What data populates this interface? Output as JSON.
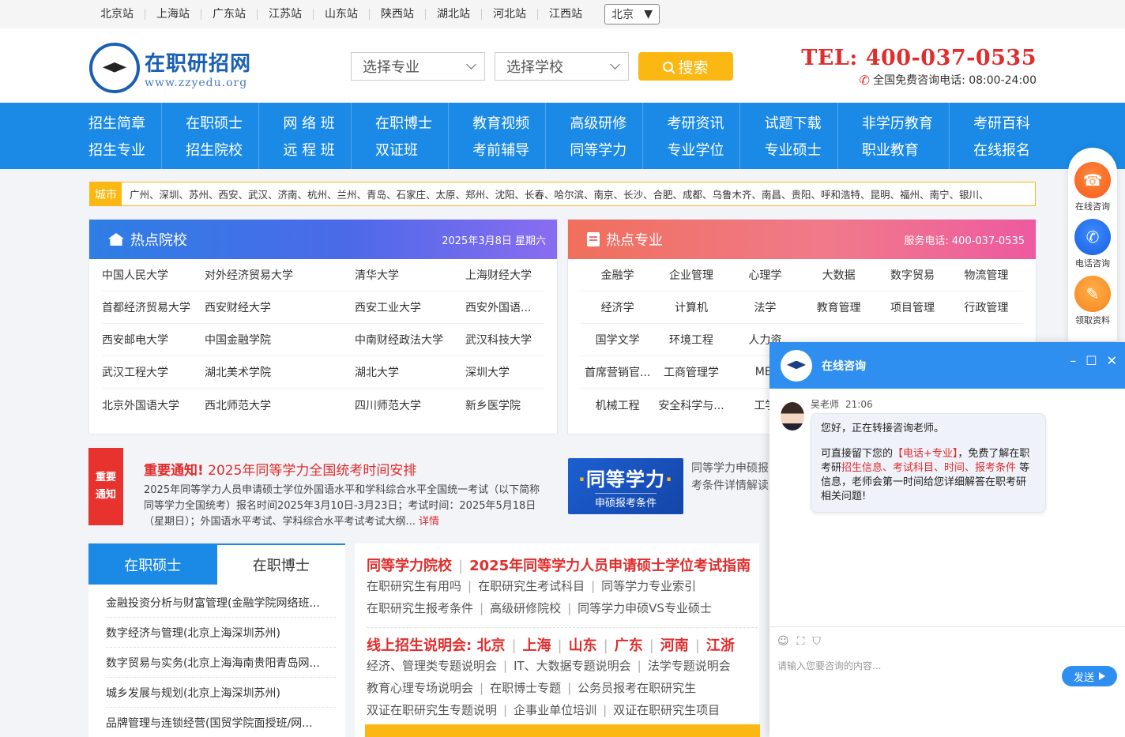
{
  "topbar": {
    "cities": [
      "北京站",
      "上海站",
      "广东站",
      "江苏站",
      "山东站",
      "陕西站",
      "湖北站",
      "河北站",
      "江西站"
    ],
    "city_select": "北京"
  },
  "header": {
    "logo_cn": "在职研招网",
    "logo_en": "www.zzyedu.org",
    "logo_ring": "WWW.ZZYEDU.ORG 在职研招网",
    "select_major": "选择专业",
    "select_school": "选择学校",
    "search_label": "搜索",
    "tel": "TEL: 400-037-0535",
    "tel_sub": "全国免费咨询电话: 08:00-24:00"
  },
  "nav": [
    [
      "招生简章",
      "招生专业"
    ],
    [
      "在职硕士",
      "招生院校"
    ],
    [
      "网 络 班",
      "远 程 班"
    ],
    [
      "在职博士",
      "双证班"
    ],
    [
      "教育视频",
      "考前辅导"
    ],
    [
      "高级研修",
      "同等学力"
    ],
    [
      "考研资讯",
      "专业学位"
    ],
    [
      "试题下载",
      "专业硕士"
    ],
    [
      "非学历教育",
      "职业教育"
    ],
    [
      "考研百科",
      "在线报名"
    ]
  ],
  "ticker": {
    "label": "城市",
    "cities": "广州、深圳、苏州、西安、武汉、济南、杭州、兰州、青岛、石家庄、太原、郑州、沈阳、长春、哈尔滨、南京、长沙、合肥、成都、乌鲁木齐、南昌、贵阳、呼和浩特、昆明、福州、南宁、银川、"
  },
  "hot_schools": {
    "title": "热点院校",
    "date": "2025年3月8日 星期六",
    "rows": [
      [
        "中国人民大学",
        "对外经济贸易大学",
        "清华大学",
        "上海财经大学"
      ],
      [
        "首都经济贸易大学",
        "西安财经大学",
        "西安工业大学",
        "西安外国语..."
      ],
      [
        "西安邮电大学",
        "中国金融学院",
        "中南财经政法大学",
        "武汉科技大学"
      ],
      [
        "武汉工程大学",
        "湖北美术学院",
        "湖北大学",
        "深圳大学"
      ],
      [
        "北京外国语大学",
        "西北师范大学",
        "四川师范大学",
        "新乡医学院"
      ]
    ]
  },
  "hot_majors": {
    "title": "热点专业",
    "service": "服务电话: 400-037-0535",
    "rows": [
      [
        "金融学",
        "企业管理",
        "心理学",
        "大数据",
        "数字贸易",
        "物流管理"
      ],
      [
        "经济学",
        "计算机",
        "法学",
        "教育管理",
        "项目管理",
        "行政管理"
      ],
      [
        "国学文学",
        "环境工程",
        "人力资",
        "",
        "",
        ""
      ],
      [
        "首席营销官...",
        "工商管理学",
        "MEI",
        "",
        "",
        ""
      ],
      [
        "机械工程",
        "安全科学与...",
        "工学",
        "",
        "",
        ""
      ]
    ]
  },
  "notice": {
    "tag_line1": "重要",
    "tag_line2": "通知",
    "title_bold": "重要通知!",
    "title_rest": " 2025年同等学力全国统考时间安排",
    "body": "2025年同等学力人员申请硕士学位外国语水平和学科综合水平全国统一考试（以下简称同等学力全国统考）报名时间2025年3月10日-3月23日；考试时间：2025年5月18日（星期日）；外国语水平考试、学科综合水平考试考试大纲...",
    "more": "详情"
  },
  "promo": {
    "big": "同等学力",
    "small": "申硕报考条件",
    "text_line1": "同等学力申硕报",
    "text_line2": "考条件详情解读"
  },
  "tabs": {
    "items": [
      "在职硕士",
      "在职博士"
    ],
    "list": [
      "金融投资分析与财富管理(金融学院网络班...",
      "数字经济与管理(北京上海深圳苏州)",
      "数字贸易与实务(北京上海海南贵阳青岛网...",
      "城乡发展与规划(北京上海深圳苏州)",
      "品牌管理与连锁经营(国贸学院面授班/网..."
    ]
  },
  "articles": {
    "h1": [
      "同等学力院校",
      "2025年同等学力人员申请硕士学位考试指南"
    ],
    "links1": [
      "在职研究生有用吗",
      "在职研究生考试科目",
      "同等学力专业索引"
    ],
    "links2": [
      "在职研究生报考条件",
      "高级研修院校",
      "同等学力申硕VS专业硕士"
    ],
    "h2": [
      "线上招生说明会: 北京",
      "上海",
      "山东",
      "广东",
      "河南",
      "江浙"
    ],
    "links3": [
      "经济、管理类专题说明会",
      "IT、大数据专题说明会",
      "法学专题说明会"
    ],
    "links4": [
      "教育心理专场说明会",
      "在职博士专题",
      "公务员报考在职研究生"
    ],
    "links5": [
      "双证在职研究生专题说明",
      "企事业单位培训",
      "双证在职研究生项目"
    ]
  },
  "side_float": [
    {
      "label": "在线咨询",
      "icon": "headset-icon"
    },
    {
      "label": "电话咨询",
      "icon": "phone-icon"
    },
    {
      "label": "领取资料",
      "icon": "document-icon"
    }
  ],
  "chat": {
    "title": "在线咨询",
    "agent": "吴老师",
    "time": "21:06",
    "msg1": "您好，正在转接咨询老师。",
    "msg2_a": "可直接留下您的",
    "msg2_red1": "【电话+专业】",
    "msg2_b": "，免费了解在职考研",
    "msg2_red2": "招生信息、考试科目、时间、报考条件",
    "msg2_c": "等信息，老师会第一时间给您详细解答在职考研相关问题!",
    "placeholder": "请输入您要咨询的内容...",
    "send": "发送"
  }
}
